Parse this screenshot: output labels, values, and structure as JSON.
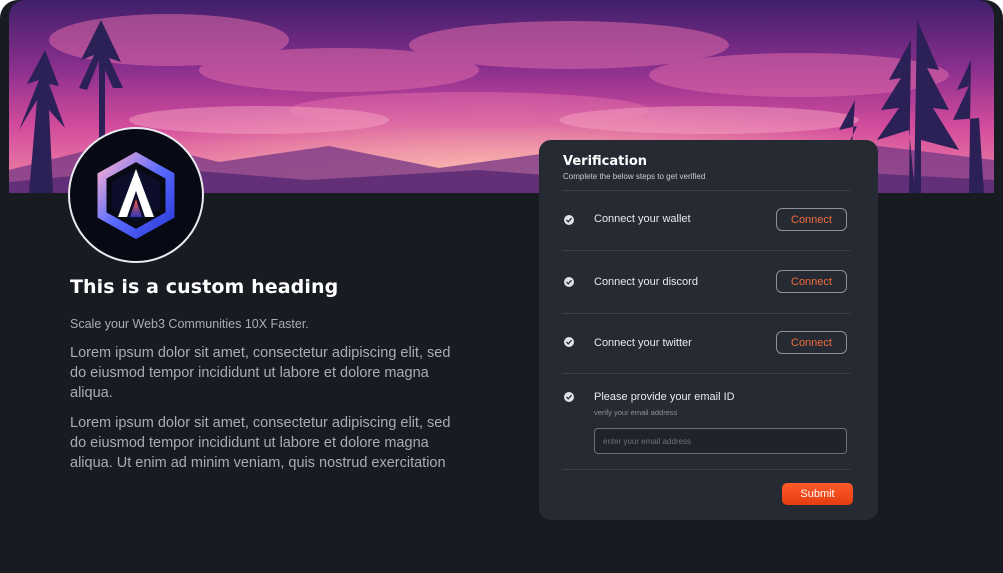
{
  "profile": {
    "heading": "This is a custom heading",
    "tagline": "Scale your Web3 Communities 10X Faster.",
    "paragraphs": [
      "Lorem ipsum dolor sit amet, consectetur adipiscing elit, sed do eiusmod tempor incididunt ut labore et dolore magna aliqua.",
      "Lorem ipsum dolor sit amet, consectetur adipiscing elit, sed do eiusmod tempor incididunt ut labore et dolore magna aliqua. Ut enim ad minim veniam, quis nostrud exercitation"
    ],
    "logo_icon": "hexagon-a-logo"
  },
  "verification": {
    "title": "Verification",
    "subtitle": "Complete the below steps to get verified",
    "steps": [
      {
        "label": "Connect your wallet",
        "button": "Connect",
        "icon": "check-circle-icon"
      },
      {
        "label": "Connect your discord",
        "button": "Connect",
        "icon": "check-circle-icon"
      },
      {
        "label": "Connect your twitter",
        "button": "Connect",
        "icon": "check-circle-icon"
      }
    ],
    "email": {
      "label": "Please provide your email ID",
      "hint": "verify your email address",
      "placeholder": "enter your email address",
      "value": ""
    },
    "submit_label": "Submit"
  },
  "colors": {
    "background": "#181c22",
    "card": "#262b33",
    "accent": "#f06a3b",
    "submit": "#ff4d1f"
  }
}
